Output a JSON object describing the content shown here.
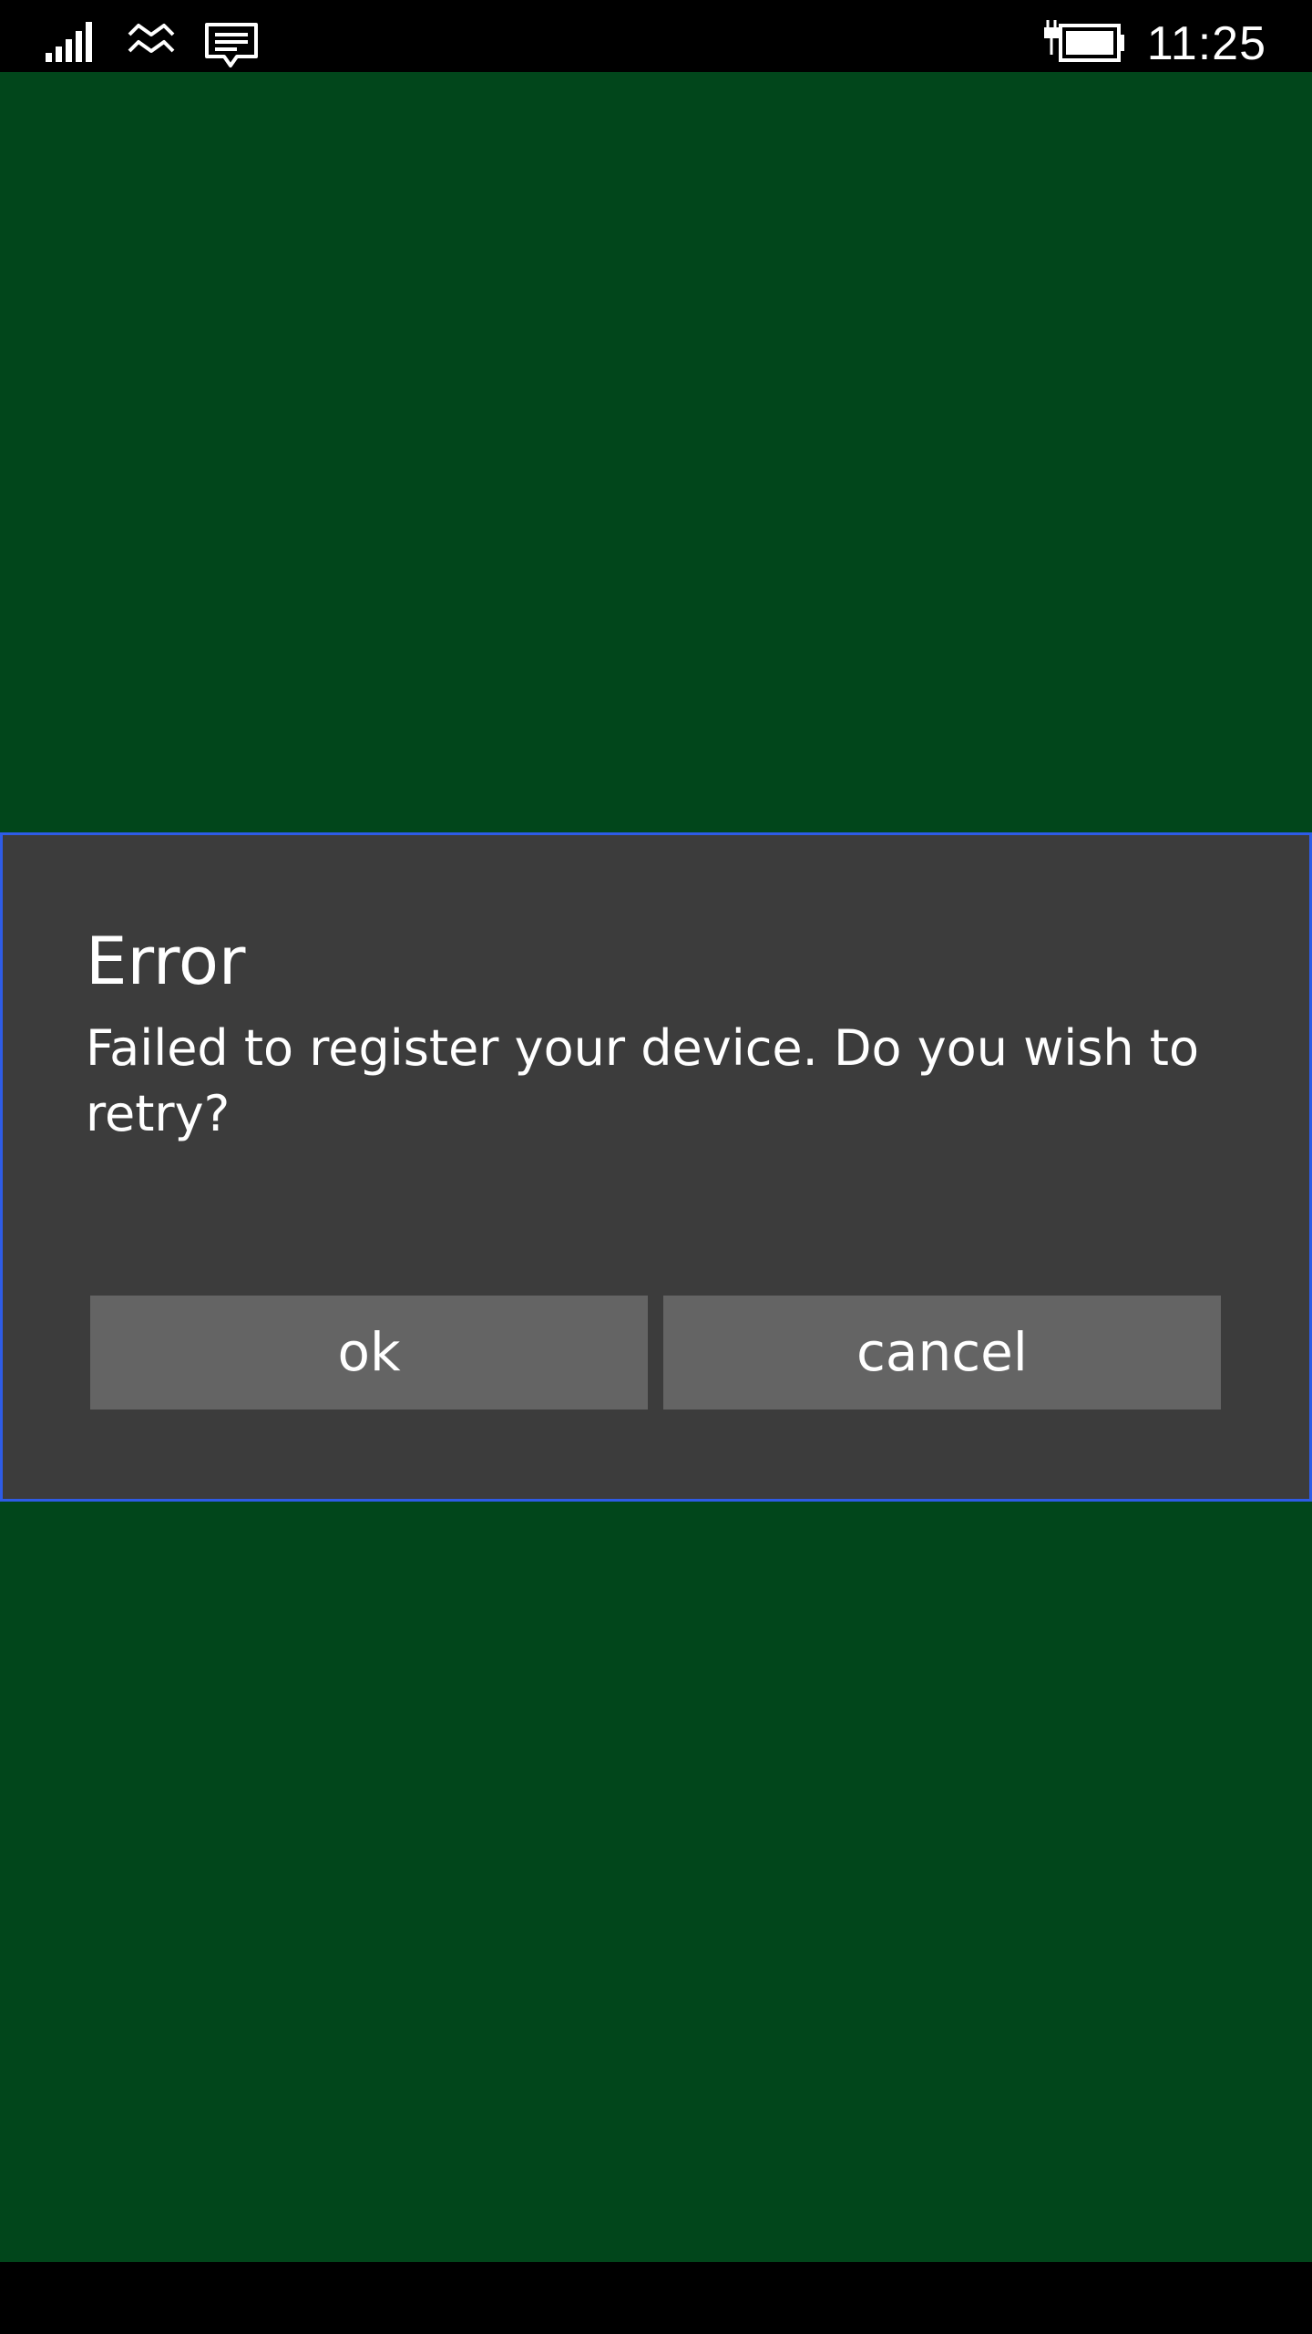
{
  "status_bar": {
    "time": "11:25",
    "icons": [
      "signal-icon",
      "wifi-icon",
      "message-icon",
      "battery-charging-icon"
    ]
  },
  "dialog": {
    "title": "Error",
    "message": "Failed to register your device. Do you wish to retry?",
    "ok_label": "ok",
    "cancel_label": "cancel"
  },
  "colors": {
    "app_background": "#01461b",
    "status_bar_background": "#000000",
    "dialog_background": "#3c3c3c",
    "dialog_border": "#2e5ce6",
    "button_background": "#646464",
    "text": "#ffffff"
  }
}
